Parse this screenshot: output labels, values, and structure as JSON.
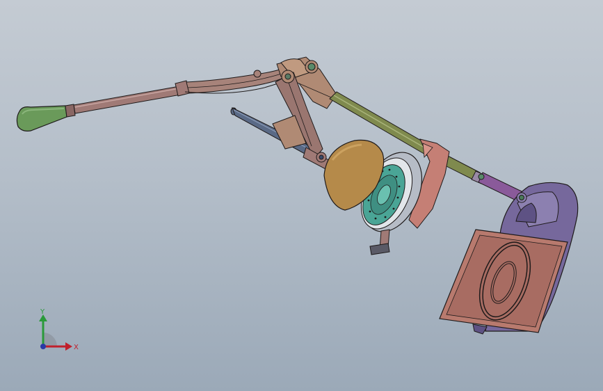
{
  "colors": {
    "background_top": "#c4cbd3",
    "background_bottom": "#9ba9b8",
    "edge": "#1e1a1a",
    "handle_knob": "#6a9a5a",
    "lever_rod": "#a07a76",
    "bracket_tan": "#b08a74",
    "olive_shaft": "#7f8a4e",
    "dome": "#b58a4a",
    "teal_disc": "#4aa596",
    "pink_bracket": "#c57f75",
    "purple_housing": "#76689c",
    "purple_rod": "#8a5a9a",
    "plate": "#b87a6e",
    "slate_rod": "#5a6a86",
    "axis_x": "#c0202c",
    "axis_y": "#2a9a3a",
    "axis_z": "#2a3aa6"
  },
  "triad": {
    "x_label": "X",
    "y_label": "Y"
  }
}
